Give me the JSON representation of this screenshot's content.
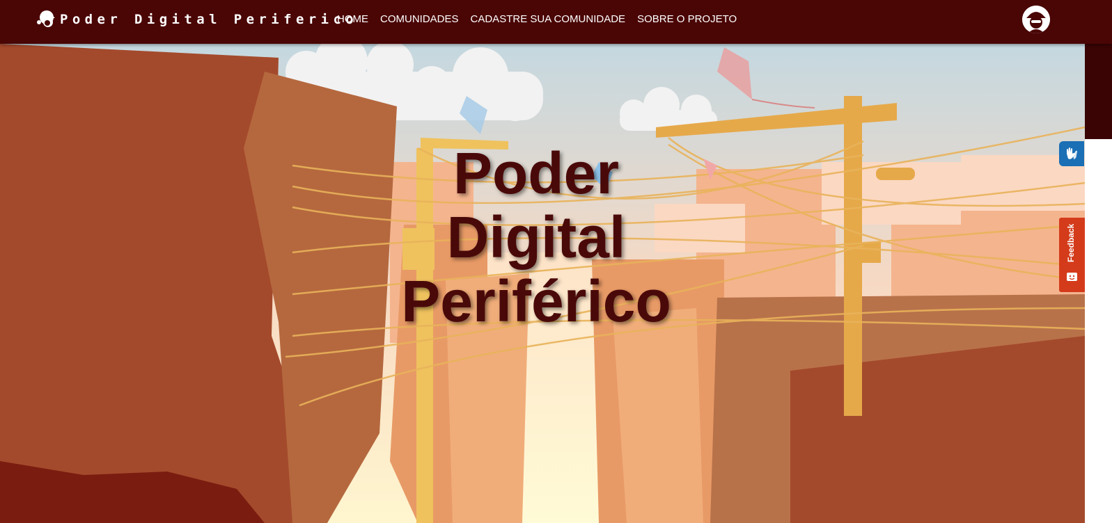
{
  "navbar": {
    "brand_text": "Poder Digital Periferico",
    "links": [
      {
        "label": "HOME"
      },
      {
        "label": "COMUNIDADES"
      },
      {
        "label": "CADASTRE SUA COMUNIDADE"
      },
      {
        "label": "SOBRE O PROJETO"
      }
    ],
    "background_color": "#4a0505",
    "logo_icon": "person-with-cap-icon",
    "avatar_icon": "user-avatar-icon"
  },
  "hero": {
    "title_lines": [
      "Poder",
      "Digital",
      "Periférico"
    ],
    "title_color": "#4a0909",
    "scene": "illustrated favela street with utility poles, wires and kites"
  },
  "widgets": {
    "accessibility_icon": "sign-language-hands-icon",
    "feedback_label": "Feedback",
    "feedback_icon": "smiley-chat-icon",
    "feedback_color": "#d43b1a"
  }
}
